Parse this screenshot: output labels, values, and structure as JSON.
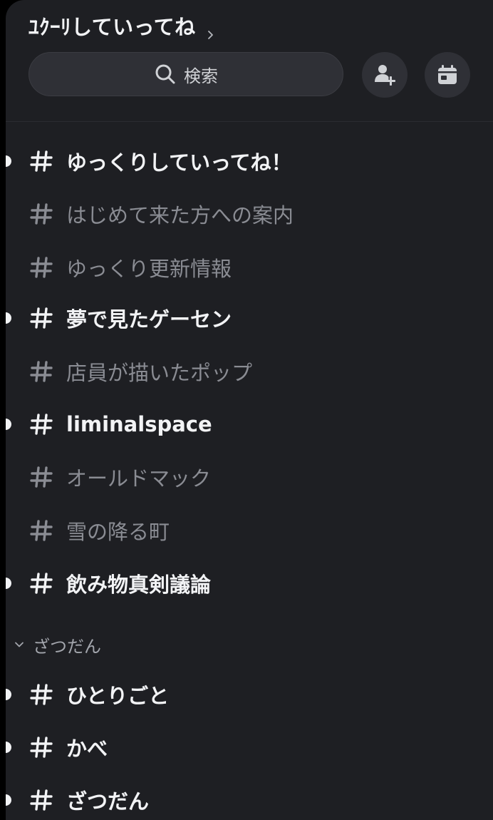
{
  "server": {
    "name": "ﾕｸｰﾘしていってね"
  },
  "search": {
    "label": "検索"
  },
  "channels_top": [
    {
      "name": "ゆっくりしていってね！",
      "unread": true
    },
    {
      "name": "はじめて来た方への案内",
      "unread": false
    },
    {
      "name": "ゆっくり更新情報",
      "unread": false
    },
    {
      "name": "夢で見たゲーセン",
      "unread": true
    },
    {
      "name": "店員が描いたポップ",
      "unread": false
    },
    {
      "name": "liminalspace",
      "unread": true
    },
    {
      "name": "オールドマック",
      "unread": false
    },
    {
      "name": "雪の降る町",
      "unread": false
    },
    {
      "name": "飲み物真剣議論",
      "unread": true
    }
  ],
  "category": {
    "label": "ざつだん"
  },
  "channels_category": [
    {
      "name": "ひとりごと",
      "unread": true
    },
    {
      "name": "かべ",
      "unread": true
    },
    {
      "name": "ざつだん",
      "unread": true
    }
  ],
  "colors": {
    "background": "#1e1f23",
    "text_unread": "#f2f3f5",
    "text_muted": "#8a8c93",
    "button_bg": "#2f3036"
  },
  "icons": {
    "title_chevron": "chevron-right-icon",
    "search": "search-icon",
    "invite": "add-user-icon",
    "events": "calendar-icon",
    "channel": "hashtag-icon",
    "category": "chevron-down-icon"
  }
}
